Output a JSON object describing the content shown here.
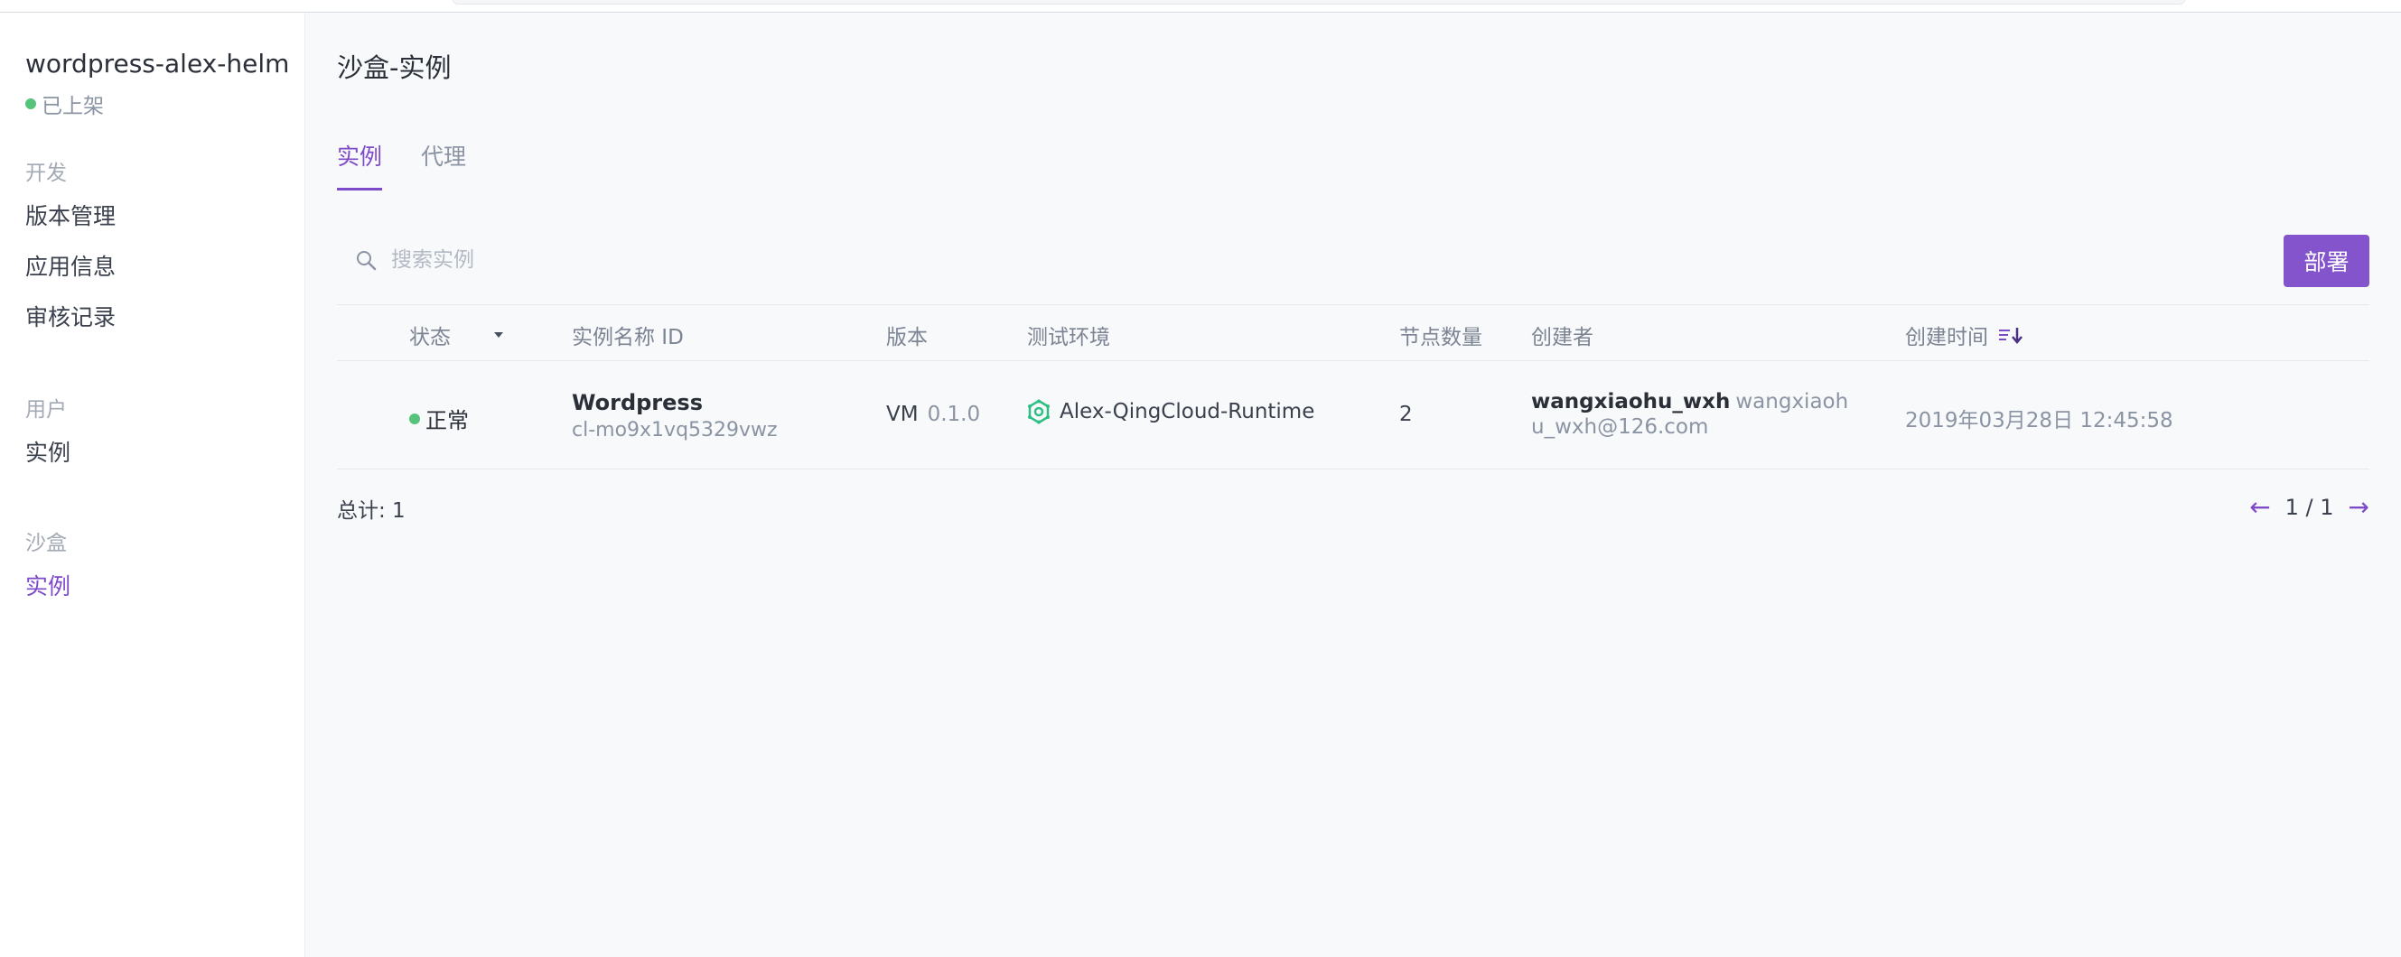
{
  "sidebar": {
    "app_name": "wordpress-alex-helm",
    "app_status": "已上架",
    "groups": [
      {
        "label": "开发",
        "items": [
          "版本管理",
          "应用信息",
          "审核记录"
        ]
      },
      {
        "label": "用户",
        "items": [
          "实例"
        ]
      },
      {
        "label": "沙盒",
        "items": [
          "实例"
        ]
      }
    ],
    "active_item": "沙盒/实例"
  },
  "page": {
    "title": "沙盒-实例",
    "tabs": [
      {
        "label": "实例",
        "active": true
      },
      {
        "label": "代理",
        "active": false
      }
    ]
  },
  "search": {
    "placeholder": "搜索实例",
    "value": ""
  },
  "deploy_button": "部署",
  "table": {
    "columns": [
      "状态",
      "实例名称 ID",
      "版本",
      "测试环境",
      "节点数量",
      "创建者",
      "创建时间"
    ],
    "rows": [
      {
        "status": "正常",
        "name": "Wordpress",
        "id": "cl-mo9x1vq5329vwz",
        "version_type": "VM",
        "version": "0.1.0",
        "environment": "Alex-QingCloud-Runtime",
        "nodes": "2",
        "creator_name": "wangxiaohu_wxh",
        "creator_email_part1": "wangxiaoh",
        "creator_email_part2": "u_wxh@126.com",
        "created_at": "2019年03月28日 12:45:58"
      }
    ]
  },
  "footer": {
    "total": "总计: 1",
    "pagination": "1 / 1",
    "prev_icon": "←",
    "next_icon": "→"
  },
  "colors": {
    "accent": "#7d4bc8",
    "button": "#8454cd",
    "status_ok": "#55c47a"
  }
}
